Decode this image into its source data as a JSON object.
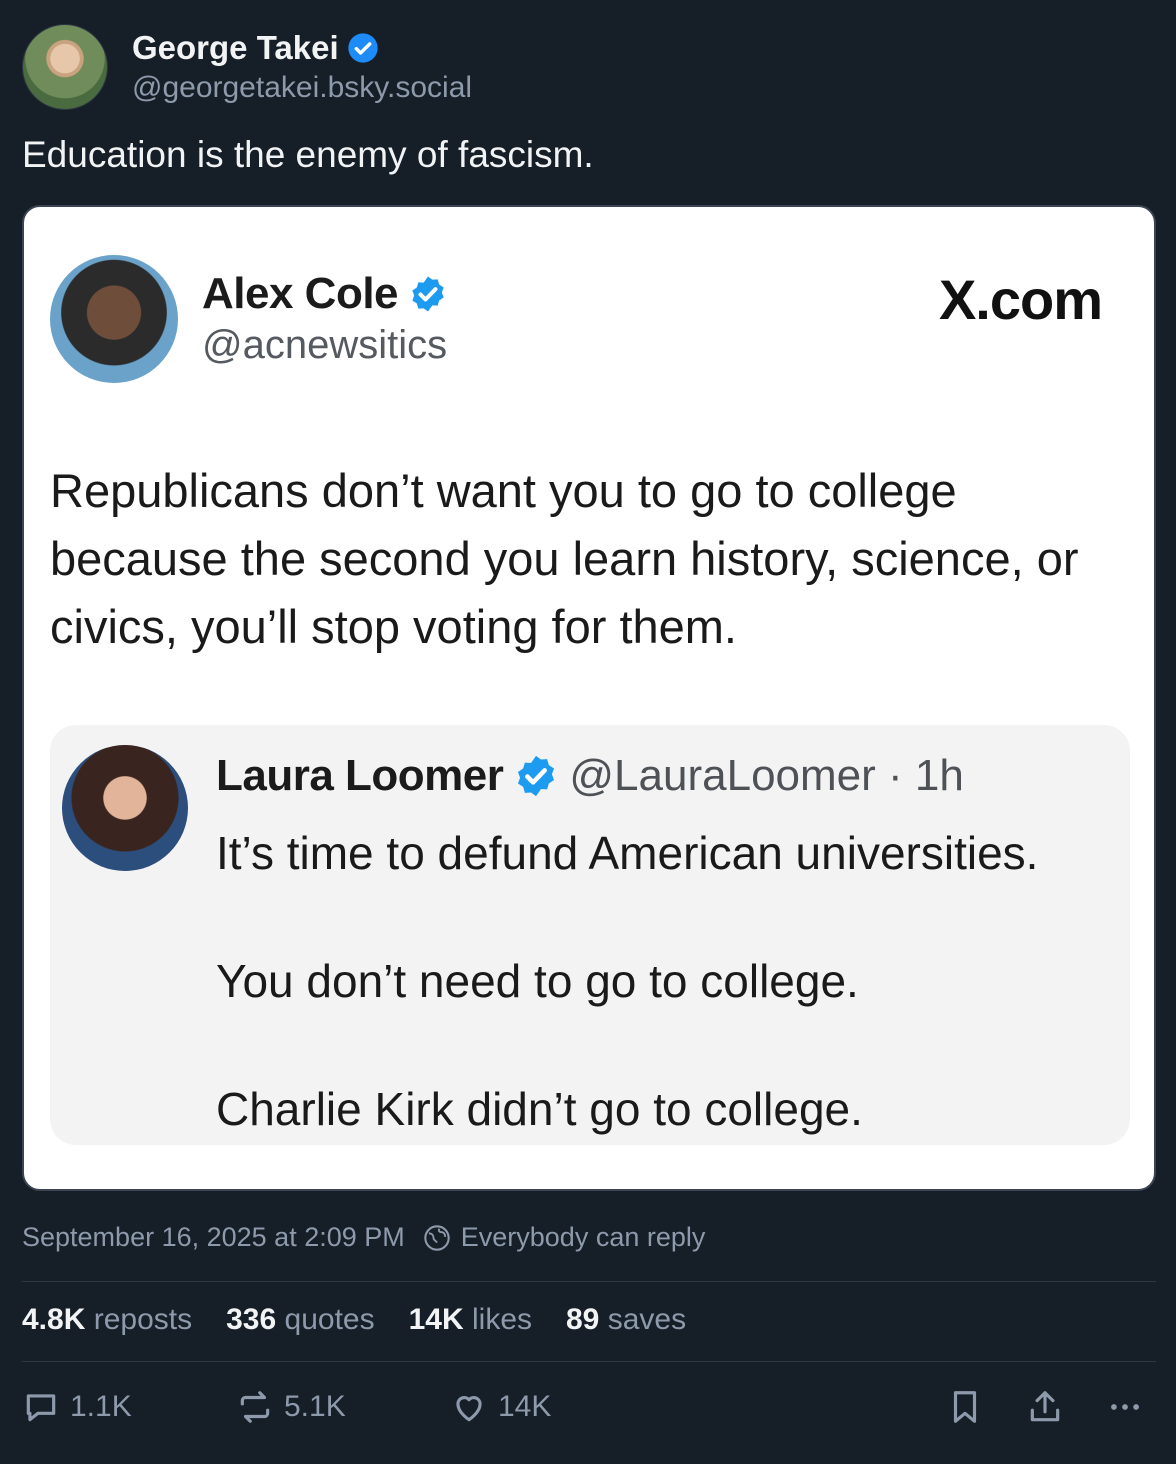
{
  "post": {
    "author_name": "George Takei",
    "author_handle": "@georgetakei.bsky.social",
    "text": "Education is the enemy of fascism.",
    "timestamp": "September 16, 2025 at 2:09 PM",
    "reply_setting": "Everybody can reply"
  },
  "embed": {
    "author_name": "Alex Cole",
    "author_handle": "@acnewsitics",
    "source": "X.com",
    "text": "Republicans don’t want you to go to college because the second you learn history, science, or civics, you’ll stop voting for them.",
    "quote": {
      "author_name": "Laura Loomer",
      "author_handle": "@LauraLoomer · 1h",
      "line1": "It’s time to defund American universities.",
      "line2": "You don’t need to go to college.",
      "line3": "Charlie Kirk didn’t go to college."
    }
  },
  "stats": {
    "reposts_num": "4.8K",
    "reposts_label": "reposts",
    "quotes_num": "336",
    "quotes_label": "quotes",
    "likes_num": "14K",
    "likes_label": "likes",
    "saves_num": "89",
    "saves_label": "saves"
  },
  "actions": {
    "reply_count": "1.1K",
    "repost_count": "5.1K",
    "like_count": "14K"
  },
  "icons": {
    "verified": "verified-check-icon",
    "reply": "comment-icon",
    "repost": "repost-icon",
    "like": "heart-icon",
    "bookmark": "bookmark-icon",
    "share": "share-icon",
    "more": "more-icon"
  },
  "colors": {
    "accent": "#1d8cf8",
    "background": "#161e27",
    "muted": "#8d9aab"
  }
}
